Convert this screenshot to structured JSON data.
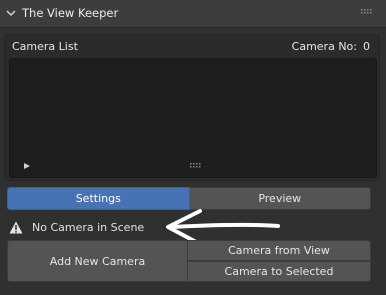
{
  "panel": {
    "title": "The View Keeper"
  },
  "camera_list": {
    "label": "Camera List",
    "count_label": "Camera No:",
    "count_value": "0"
  },
  "tabs": [
    {
      "label": "Settings",
      "active": true
    },
    {
      "label": "Preview",
      "active": false
    }
  ],
  "warning": {
    "text": "No Camera in Scene",
    "icon": "warning-triangle-icon"
  },
  "buttons": {
    "add_new": "Add New Camera",
    "from_view": "Camera from View",
    "to_selected": "Camera to Selected"
  },
  "colors": {
    "panel_bg": "#303030",
    "header_bg": "#3d3d3d",
    "accent": "#4772b3",
    "button_bg": "#545454",
    "list_bg": "#1e1e1e"
  }
}
